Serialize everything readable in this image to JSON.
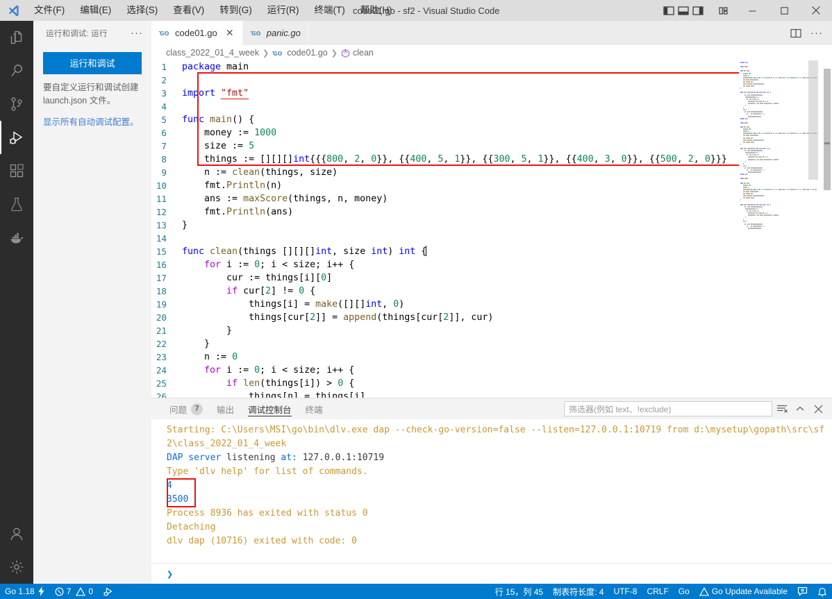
{
  "window": {
    "title": "code01.go - sf2 - Visual Studio Code",
    "minimize": "─",
    "maximize": "□",
    "close": "✕"
  },
  "menu": {
    "items": [
      {
        "label": "文件(F)",
        "name": "menu-file"
      },
      {
        "label": "编辑(E)",
        "name": "menu-edit"
      },
      {
        "label": "选择(S)",
        "name": "menu-selection"
      },
      {
        "label": "查看(V)",
        "name": "menu-view"
      },
      {
        "label": "转到(G)",
        "name": "menu-goto"
      },
      {
        "label": "运行(R)",
        "name": "menu-run"
      },
      {
        "label": "终端(T)",
        "name": "menu-terminal"
      },
      {
        "label": "帮助(H)",
        "name": "menu-help"
      }
    ]
  },
  "activitybar": {
    "items": [
      {
        "name": "explorer-icon",
        "title": "资源管理器"
      },
      {
        "name": "search-icon",
        "title": "搜索"
      },
      {
        "name": "source-control-icon",
        "title": "源代码管理"
      },
      {
        "name": "run-debug-icon",
        "title": "运行和调试",
        "active": true
      },
      {
        "name": "extensions-icon",
        "title": "扩展"
      },
      {
        "name": "testing-icon",
        "title": "测试"
      },
      {
        "name": "docker-icon",
        "title": "Docker"
      }
    ],
    "bottom": [
      {
        "name": "accounts-icon",
        "title": "帐户"
      },
      {
        "name": "settings-gear-icon",
        "title": "管理"
      }
    ]
  },
  "sidebar": {
    "title": "运行和调试: 运行",
    "more_actions": "···",
    "run_debug_button": "运行和调试",
    "description": "要自定义运行和调试创建 launch.json 文件。",
    "link": "显示所有自动调试配置。"
  },
  "editor": {
    "tabs": [
      {
        "label": "code01.go",
        "icon": "go-file-icon",
        "active": true,
        "close": "✕"
      },
      {
        "label": "panic.go",
        "icon": "go-file-icon",
        "active": false,
        "preview": true
      }
    ],
    "actions": [
      {
        "name": "split-editor-icon"
      },
      {
        "name": "more-actions-icon",
        "glyph": "···"
      }
    ],
    "breadcrumb": [
      {
        "label": "class_2022_01_4_week",
        "icon": ""
      },
      {
        "label": "code01.go",
        "icon": "go-file-icon"
      },
      {
        "label": "clean",
        "icon": "symbol-method-icon"
      }
    ],
    "code_lines": [
      {
        "n": 1,
        "tokens": [
          {
            "t": "package ",
            "c": "kw"
          },
          {
            "t": "main",
            "c": ""
          }
        ]
      },
      {
        "n": 2,
        "tokens": []
      },
      {
        "n": 3,
        "tokens": [
          {
            "t": "import ",
            "c": "kw"
          },
          {
            "t": "\"fmt\"",
            "c": "str hl-str"
          }
        ]
      },
      {
        "n": 4,
        "tokens": []
      },
      {
        "n": 5,
        "tokens": [
          {
            "t": "func ",
            "c": "kw"
          },
          {
            "t": "main",
            "c": "fn"
          },
          {
            "t": "() {",
            "c": ""
          }
        ]
      },
      {
        "n": 6,
        "tokens": [
          {
            "t": "    money := ",
            "c": ""
          },
          {
            "t": "1000",
            "c": "num"
          }
        ]
      },
      {
        "n": 7,
        "tokens": [
          {
            "t": "    size := ",
            "c": ""
          },
          {
            "t": "5",
            "c": "num"
          }
        ]
      },
      {
        "n": 8,
        "tokens": [
          {
            "t": "    things := [][][]",
            "c": ""
          },
          {
            "t": "int",
            "c": "typ"
          },
          {
            "t": "{{{",
            "c": ""
          },
          {
            "t": "800",
            "c": "num"
          },
          {
            "t": ", ",
            "c": ""
          },
          {
            "t": "2",
            "c": "num"
          },
          {
            "t": ", ",
            "c": ""
          },
          {
            "t": "0",
            "c": "num"
          },
          {
            "t": "}}, {{",
            "c": ""
          },
          {
            "t": "400",
            "c": "num"
          },
          {
            "t": ", ",
            "c": ""
          },
          {
            "t": "5",
            "c": "num"
          },
          {
            "t": ", ",
            "c": ""
          },
          {
            "t": "1",
            "c": "num"
          },
          {
            "t": "}}, {{",
            "c": ""
          },
          {
            "t": "300",
            "c": "num"
          },
          {
            "t": ", ",
            "c": ""
          },
          {
            "t": "5",
            "c": "num"
          },
          {
            "t": ", ",
            "c": ""
          },
          {
            "t": "1",
            "c": "num"
          },
          {
            "t": "}}, {{",
            "c": ""
          },
          {
            "t": "400",
            "c": "num"
          },
          {
            "t": ", ",
            "c": ""
          },
          {
            "t": "3",
            "c": "num"
          },
          {
            "t": ", ",
            "c": ""
          },
          {
            "t": "0",
            "c": "num"
          },
          {
            "t": "}}, {{",
            "c": ""
          },
          {
            "t": "500",
            "c": "num"
          },
          {
            "t": ", ",
            "c": ""
          },
          {
            "t": "2",
            "c": "num"
          },
          {
            "t": ", ",
            "c": ""
          },
          {
            "t": "0",
            "c": "num"
          },
          {
            "t": "}}}",
            "c": ""
          }
        ]
      },
      {
        "n": 9,
        "tokens": [
          {
            "t": "    n := ",
            "c": ""
          },
          {
            "t": "clean",
            "c": "fn"
          },
          {
            "t": "(things, size)",
            "c": ""
          }
        ]
      },
      {
        "n": 10,
        "tokens": [
          {
            "t": "    fmt.",
            "c": ""
          },
          {
            "t": "Println",
            "c": "fn"
          },
          {
            "t": "(n)",
            "c": ""
          }
        ]
      },
      {
        "n": 11,
        "tokens": [
          {
            "t": "    ans := ",
            "c": ""
          },
          {
            "t": "maxScore",
            "c": "fn"
          },
          {
            "t": "(things, n, money)",
            "c": ""
          }
        ]
      },
      {
        "n": 12,
        "tokens": [
          {
            "t": "    fmt.",
            "c": ""
          },
          {
            "t": "Println",
            "c": "fn"
          },
          {
            "t": "(ans)",
            "c": ""
          }
        ]
      },
      {
        "n": 13,
        "tokens": [
          {
            "t": "}",
            "c": ""
          }
        ]
      },
      {
        "n": 14,
        "tokens": []
      },
      {
        "n": 15,
        "tokens": [
          {
            "t": "func ",
            "c": "kw"
          },
          {
            "t": "clean",
            "c": "fn"
          },
          {
            "t": "(things [][][]",
            "c": ""
          },
          {
            "t": "int",
            "c": "typ"
          },
          {
            "t": ", size ",
            "c": ""
          },
          {
            "t": "int",
            "c": "typ"
          },
          {
            "t": ") ",
            "c": ""
          },
          {
            "t": "int",
            "c": "typ"
          },
          {
            "t": " {",
            "c": ""
          }
        ]
      },
      {
        "n": 16,
        "tokens": [
          {
            "t": "    ",
            "c": ""
          },
          {
            "t": "for",
            "c": "kwp"
          },
          {
            "t": " i := ",
            "c": ""
          },
          {
            "t": "0",
            "c": "num"
          },
          {
            "t": "; i < size; i++ {",
            "c": ""
          }
        ]
      },
      {
        "n": 17,
        "tokens": [
          {
            "t": "        cur := things[i][",
            "c": ""
          },
          {
            "t": "0",
            "c": "num"
          },
          {
            "t": "]",
            "c": ""
          }
        ]
      },
      {
        "n": 18,
        "tokens": [
          {
            "t": "        ",
            "c": ""
          },
          {
            "t": "if",
            "c": "kwp"
          },
          {
            "t": " cur[",
            "c": ""
          },
          {
            "t": "2",
            "c": "num"
          },
          {
            "t": "] != ",
            "c": ""
          },
          {
            "t": "0",
            "c": "num"
          },
          {
            "t": " {",
            "c": ""
          }
        ]
      },
      {
        "n": 19,
        "tokens": [
          {
            "t": "            things[i] = ",
            "c": ""
          },
          {
            "t": "make",
            "c": "fn"
          },
          {
            "t": "([][]",
            "c": ""
          },
          {
            "t": "int",
            "c": "typ"
          },
          {
            "t": ", ",
            "c": ""
          },
          {
            "t": "0",
            "c": "num"
          },
          {
            "t": ")",
            "c": ""
          }
        ]
      },
      {
        "n": 20,
        "tokens": [
          {
            "t": "            things[cur[",
            "c": ""
          },
          {
            "t": "2",
            "c": "num"
          },
          {
            "t": "]] = ",
            "c": ""
          },
          {
            "t": "append",
            "c": "fn"
          },
          {
            "t": "(things[cur[",
            "c": ""
          },
          {
            "t": "2",
            "c": "num"
          },
          {
            "t": "]], cur)",
            "c": ""
          }
        ]
      },
      {
        "n": 21,
        "tokens": [
          {
            "t": "        }",
            "c": ""
          }
        ]
      },
      {
        "n": 22,
        "tokens": [
          {
            "t": "    }",
            "c": ""
          }
        ]
      },
      {
        "n": 23,
        "tokens": [
          {
            "t": "    n := ",
            "c": ""
          },
          {
            "t": "0",
            "c": "num"
          }
        ]
      },
      {
        "n": 24,
        "tokens": [
          {
            "t": "    ",
            "c": ""
          },
          {
            "t": "for",
            "c": "kwp"
          },
          {
            "t": " i := ",
            "c": ""
          },
          {
            "t": "0",
            "c": "num"
          },
          {
            "t": "; i < size; i++ {",
            "c": ""
          }
        ]
      },
      {
        "n": 25,
        "tokens": [
          {
            "t": "        ",
            "c": ""
          },
          {
            "t": "if",
            "c": "kwp"
          },
          {
            "t": " ",
            "c": ""
          },
          {
            "t": "len",
            "c": "fn"
          },
          {
            "t": "(things[i]) > ",
            "c": ""
          },
          {
            "t": "0",
            "c": "num"
          },
          {
            "t": " {",
            "c": ""
          }
        ]
      },
      {
        "n": 26,
        "tokens": [
          {
            "t": "            things[n] = things[i]",
            "c": ""
          }
        ]
      }
    ],
    "cursor_line": 15
  },
  "panel": {
    "tabs": [
      {
        "label": "问题",
        "badge": "7",
        "active": false,
        "name": "tab-problems"
      },
      {
        "label": "输出",
        "badge": "",
        "active": false,
        "name": "tab-output"
      },
      {
        "label": "调试控制台",
        "badge": "",
        "active": true,
        "name": "tab-debug-console"
      },
      {
        "label": "终端",
        "badge": "",
        "active": false,
        "name": "tab-terminal"
      }
    ],
    "filter_placeholder": "筛选器(例如 text、!exclude)",
    "actions": [
      {
        "name": "clear-console-icon"
      },
      {
        "name": "maximize-panel-icon",
        "glyph": "⌃"
      },
      {
        "name": "close-panel-icon",
        "glyph": "✕"
      }
    ],
    "console_lines": [
      {
        "segments": [
          {
            "t": "Starting: C:\\Users\\MSI\\go\\bin\\dlv.exe dap --check-go-version=false --listen=127.0.0.1:10719 from d:\\mysetup\\gopath\\src\\sf",
            "c": "c-orange"
          }
        ]
      },
      {
        "segments": [
          {
            "t": "2\\class_2022_01_4_week",
            "c": "c-orange"
          }
        ]
      },
      {
        "segments": [
          {
            "t": "DAP server ",
            "c": "c-blue"
          },
          {
            "t": "listening",
            "c": "c-dark"
          },
          {
            "t": " at: ",
            "c": "c-blue"
          },
          {
            "t": "127.0.0.1:10719",
            "c": "c-dark"
          }
        ]
      },
      {
        "segments": [
          {
            "t": "Type 'dlv help' for list of commands.",
            "c": "c-orange"
          }
        ]
      },
      {
        "segments": [
          {
            "t": "4",
            "c": "c-blue"
          }
        ],
        "highlight": true
      },
      {
        "segments": [
          {
            "t": "3500",
            "c": "c-blue"
          }
        ],
        "highlight": true
      },
      {
        "segments": [
          {
            "t": "Process 8936 has exited with status 0",
            "c": "c-orange"
          }
        ]
      },
      {
        "segments": [
          {
            "t": "Detaching",
            "c": "c-orange"
          }
        ]
      },
      {
        "segments": [
          {
            "t": "dlv dap (10716) exited with code: 0",
            "c": "c-orange"
          }
        ]
      }
    ],
    "repl_prompt": "❯"
  },
  "statusbar": {
    "left": [
      {
        "label": "Go 1.18",
        "icon": "go-env-lightning-icon",
        "name": "status-go-version"
      },
      {
        "label": "7",
        "icon": "error-icon",
        "label2": "0",
        "icon2": "warning-icon",
        "name": "status-problems"
      },
      {
        "label": "",
        "icon": "go-debug-icon",
        "name": "status-go-debug"
      }
    ],
    "right": [
      {
        "label": "行 15，列 45",
        "name": "status-cursor-position"
      },
      {
        "label": "制表符长度: 4",
        "name": "status-tab-size"
      },
      {
        "label": "UTF-8",
        "name": "status-encoding"
      },
      {
        "label": "CRLF",
        "name": "status-eol"
      },
      {
        "label": "Go",
        "name": "status-language-mode"
      },
      {
        "label": "Go Update Available",
        "icon": "warning-icon",
        "name": "status-go-update"
      },
      {
        "label": "",
        "icon": "feedback-icon",
        "name": "status-feedback"
      },
      {
        "label": "",
        "icon": "bell-icon",
        "name": "status-notifications"
      }
    ]
  },
  "colors": {
    "accent": "#007acc",
    "titlebar_bg": "#dddddd",
    "activitybar_bg": "#2c2c2c",
    "sidebar_bg": "#f3f3f3",
    "editor_bg": "#ffffff",
    "highlight_box": "#ee1111",
    "console_orange": "#cd9731",
    "console_blue": "#0b6cda"
  }
}
